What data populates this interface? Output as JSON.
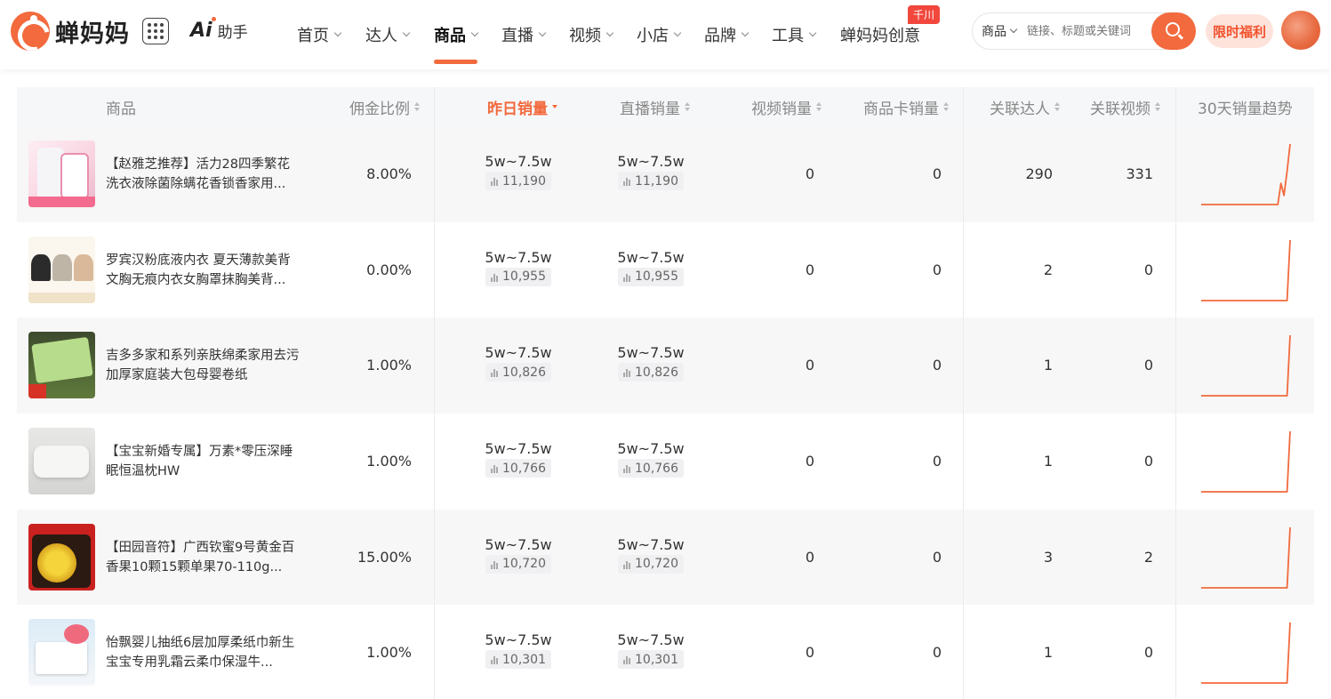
{
  "header": {
    "logo_text": "蝉妈妈",
    "ai_label": "助手",
    "nav": [
      {
        "label": "首页",
        "chevron": true
      },
      {
        "label": "达人",
        "chevron": true
      },
      {
        "label": "商品",
        "chevron": true,
        "active": true
      },
      {
        "label": "直播",
        "chevron": true
      },
      {
        "label": "视频",
        "chevron": true
      },
      {
        "label": "小店",
        "chevron": true
      },
      {
        "label": "品牌",
        "chevron": true
      },
      {
        "label": "工具",
        "chevron": true
      },
      {
        "label": "蝉妈妈创意",
        "chevron": false,
        "badge": "千川"
      }
    ],
    "search": {
      "type_label": "商品",
      "placeholder": "链接、标题或关键词"
    },
    "promo_label": "限时福利"
  },
  "table": {
    "columns": {
      "product": "商品",
      "commission": "佣金比例",
      "yesterday_sales": "昨日销量",
      "live_sales": "直播销量",
      "video_sales": "视频销量",
      "card_sales": "商品卡销量",
      "linked_creators": "关联达人",
      "linked_videos": "关联视频",
      "trend": "30天销量趋势"
    },
    "rows": [
      {
        "name": "【赵雅芝推荐】活力28四季繁花洗衣液除菌除螨花香锁香家用...",
        "commission": "8.00%",
        "yesterday_range": "5w~7.5w",
        "yesterday_exact": "11,190",
        "live_range": "5w~7.5w",
        "live_exact": "11,190",
        "video_sales": "0",
        "card_sales": "0",
        "creators": "290",
        "videos": "331",
        "thumb": "detergent"
      },
      {
        "name": "罗宾汉粉底液内衣 夏天薄款美背文胸无痕内衣女胸罩抹胸美背...",
        "commission": "0.00%",
        "yesterday_range": "5w~7.5w",
        "yesterday_exact": "10,955",
        "live_range": "5w~7.5w",
        "live_exact": "10,955",
        "video_sales": "0",
        "card_sales": "0",
        "creators": "2",
        "videos": "0",
        "thumb": "bra"
      },
      {
        "name": "吉多多家和系列亲肤绵柔家用去污加厚家庭装大包母婴卷纸",
        "commission": "1.00%",
        "yesterday_range": "5w~7.5w",
        "yesterday_exact": "10,826",
        "live_range": "5w~7.5w",
        "live_exact": "10,826",
        "video_sales": "0",
        "card_sales": "0",
        "creators": "1",
        "videos": "0",
        "thumb": "tissue-roll"
      },
      {
        "name": "【宝宝新婚专属】万素*零压深睡眠恒温枕HW",
        "commission": "1.00%",
        "yesterday_range": "5w~7.5w",
        "yesterday_exact": "10,766",
        "live_range": "5w~7.5w",
        "live_exact": "10,766",
        "video_sales": "0",
        "card_sales": "0",
        "creators": "1",
        "videos": "0",
        "thumb": "pillow"
      },
      {
        "name": "【田园音符】广西钦蜜9号黄金百香果10颗15颗单果70-110g...",
        "commission": "15.00%",
        "yesterday_range": "5w~7.5w",
        "yesterday_exact": "10,720",
        "live_range": "5w~7.5w",
        "live_exact": "10,720",
        "video_sales": "0",
        "card_sales": "0",
        "creators": "3",
        "videos": "2",
        "thumb": "passion-fruit"
      },
      {
        "name": "怡飘婴儿抽纸6层加厚柔纸巾新生宝宝专用乳霜云柔巾保湿牛...",
        "commission": "1.00%",
        "yesterday_range": "5w~7.5w",
        "yesterday_exact": "10,301",
        "live_range": "5w~7.5w",
        "live_exact": "10,301",
        "video_sales": "0",
        "card_sales": "0",
        "creators": "1",
        "videos": "0",
        "thumb": "baby-tissue"
      }
    ]
  },
  "colors": {
    "accent": "#f26a3d",
    "trend_line": "#f26a3d"
  }
}
